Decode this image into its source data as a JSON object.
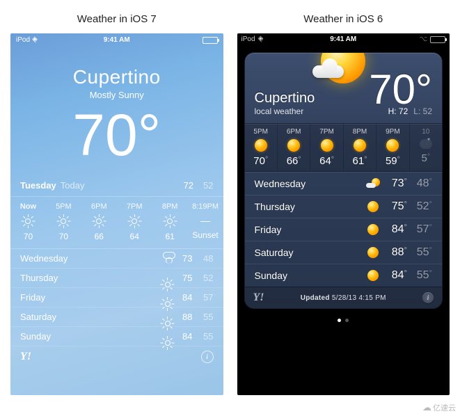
{
  "titles": {
    "ios7": "Weather in iOS 7",
    "ios6": "Weather in iOS 6"
  },
  "ios7": {
    "statusbar": {
      "device": "iPod",
      "time": "9:41 AM"
    },
    "city": "Cupertino",
    "condition": "Mostly Sunny",
    "temp": "70°",
    "today": {
      "day": "Tuesday",
      "label": "Today",
      "hi": "72",
      "lo": "52"
    },
    "hourly": [
      {
        "time": "Now",
        "temp": "70",
        "icon": "sun"
      },
      {
        "time": "5PM",
        "temp": "70",
        "icon": "sun"
      },
      {
        "time": "6PM",
        "temp": "66",
        "icon": "sun"
      },
      {
        "time": "7PM",
        "temp": "64",
        "icon": "sun"
      },
      {
        "time": "8PM",
        "temp": "61",
        "icon": "sun"
      },
      {
        "time": "8:19PM",
        "temp": "Sunset",
        "icon": "sunset"
      }
    ],
    "forecast": [
      {
        "day": "Wednesday",
        "icon": "pcloud",
        "hi": "73",
        "lo": "48"
      },
      {
        "day": "Thursday",
        "icon": "sun",
        "hi": "75",
        "lo": "52"
      },
      {
        "day": "Friday",
        "icon": "sun",
        "hi": "84",
        "lo": "57"
      },
      {
        "day": "Saturday",
        "icon": "sun",
        "hi": "88",
        "lo": "55"
      },
      {
        "day": "Sunday",
        "icon": "sun",
        "hi": "84",
        "lo": "55"
      }
    ]
  },
  "ios6": {
    "statusbar": {
      "device": "iPod",
      "time": "9:41 AM"
    },
    "city": "Cupertino",
    "subtitle": "local weather",
    "temp": "70°",
    "hi_label": "H:",
    "hi": "72",
    "lo_label": "L:",
    "lo": "52",
    "hourly": [
      {
        "time": "5PM",
        "temp": "70",
        "icon": "sun"
      },
      {
        "time": "6PM",
        "temp": "66",
        "icon": "sun"
      },
      {
        "time": "7PM",
        "temp": "64",
        "icon": "sun"
      },
      {
        "time": "8PM",
        "temp": "61",
        "icon": "sun"
      },
      {
        "time": "9PM",
        "temp": "59",
        "icon": "sun"
      },
      {
        "time": "10",
        "temp": "5",
        "icon": "night"
      }
    ],
    "forecast": [
      {
        "day": "Wednesday",
        "icon": "pcloud",
        "hi": "73",
        "lo": "48"
      },
      {
        "day": "Thursday",
        "icon": "sun",
        "hi": "75",
        "lo": "52"
      },
      {
        "day": "Friday",
        "icon": "sun",
        "hi": "84",
        "lo": "57"
      },
      {
        "day": "Saturday",
        "icon": "sun",
        "hi": "88",
        "lo": "55"
      },
      {
        "day": "Sunday",
        "icon": "sun",
        "hi": "84",
        "lo": "55"
      }
    ],
    "updated_label": "Updated",
    "updated_time": "5/28/13 4:15 PM"
  },
  "watermark": "亿速云"
}
